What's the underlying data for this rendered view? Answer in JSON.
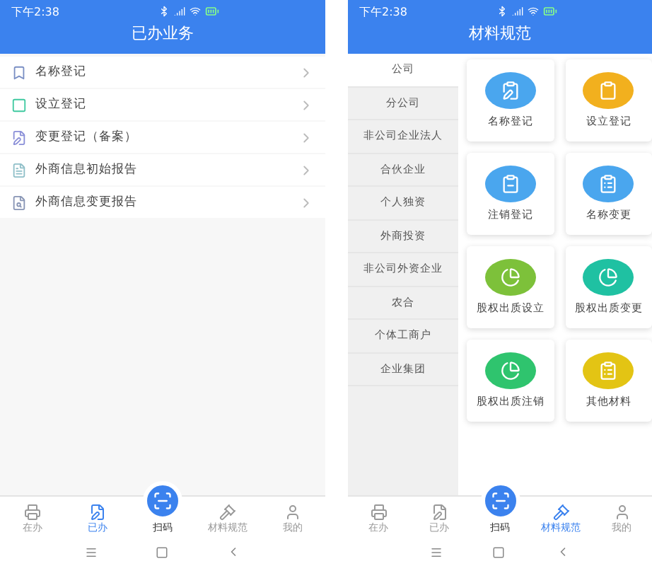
{
  "screens": [
    {
      "status_bar": {
        "time": "下午2:38"
      },
      "title": "已办业务",
      "kind": "list",
      "items": [
        {
          "label": "名称登记"
        },
        {
          "label": "设立登记"
        },
        {
          "label": "变更登记（备案）"
        },
        {
          "label": "外商信息初始报告"
        },
        {
          "label": "外商信息变更报告"
        }
      ],
      "tab_bar": [
        {
          "label": "在办",
          "selected": false
        },
        {
          "label": "已办",
          "selected": true
        },
        {
          "label": "扫码",
          "selected": false,
          "kind": "scan"
        },
        {
          "label": "材料规范",
          "selected": false
        },
        {
          "label": "我的",
          "selected": false
        }
      ]
    },
    {
      "status_bar": {
        "time": "下午2:38"
      },
      "title": "材料规范",
      "kind": "grid",
      "categories": [
        {
          "label": "公司",
          "selected": true
        },
        {
          "label": "分公司",
          "selected": false
        },
        {
          "label": "非公司企业法人",
          "selected": false
        },
        {
          "label": "合伙企业",
          "selected": false
        },
        {
          "label": "个人独资",
          "selected": false
        },
        {
          "label": "外商投资",
          "selected": false
        },
        {
          "label": "非公司外资企业",
          "selected": false
        },
        {
          "label": "农合",
          "selected": false
        },
        {
          "label": "个体工商户",
          "selected": false
        },
        {
          "label": "企业集团",
          "selected": false
        }
      ],
      "cards": [
        {
          "label": "名称登记",
          "color": "#4aa6ee"
        },
        {
          "label": "设立登记",
          "color": "#f2b01e"
        },
        {
          "label": "注销登记",
          "color": "#4aa6ee"
        },
        {
          "label": "名称变更",
          "color": "#4aa6ee"
        },
        {
          "label": "股权出质设立",
          "color": "#7dc13a"
        },
        {
          "label": "股权出质变更",
          "color": "#1fc1a2"
        },
        {
          "label": "股权出质注销",
          "color": "#2fc46e"
        },
        {
          "label": "其他材料",
          "color": "#e3c414"
        }
      ],
      "tab_bar": [
        {
          "label": "在办",
          "selected": false
        },
        {
          "label": "已办",
          "selected": false
        },
        {
          "label": "扫码",
          "selected": false,
          "kind": "scan"
        },
        {
          "label": "材料规范",
          "selected": true
        },
        {
          "label": "我的",
          "selected": false
        }
      ]
    }
  ]
}
